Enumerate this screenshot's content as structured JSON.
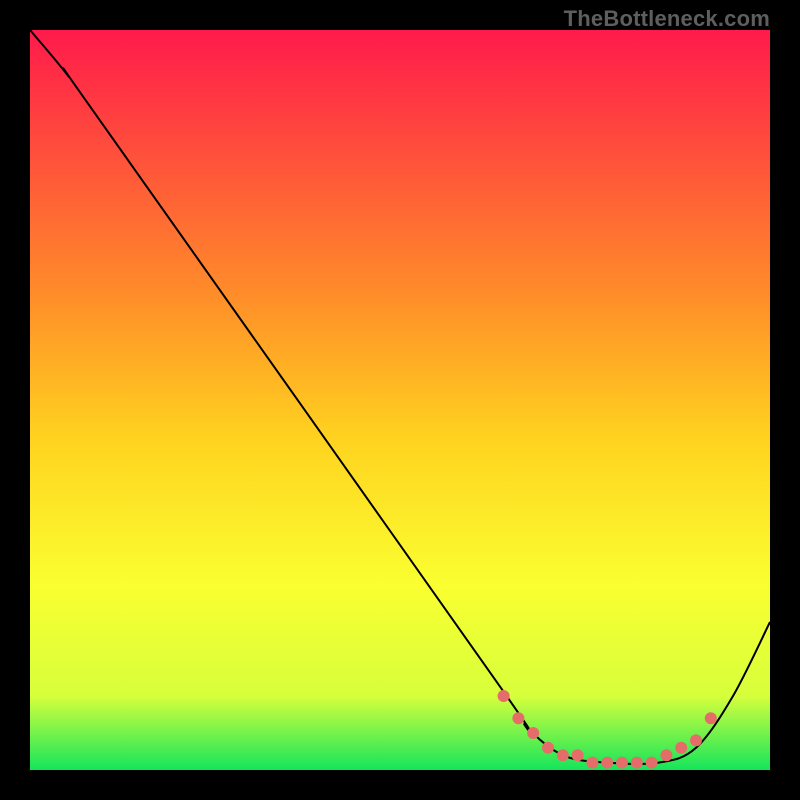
{
  "watermark": "TheBottleneck.com",
  "colors": {
    "bg": "#000000",
    "line": "#000000",
    "marker": "#e46d6a",
    "grad_top": "#ff1a4b",
    "grad_mid_up": "#ff8a2a",
    "grad_mid": "#ffd21f",
    "grad_mid_low": "#faff30",
    "grad_low": "#d6ff3b",
    "grad_bottom": "#14e55b"
  },
  "chart_data": {
    "type": "line",
    "title": "",
    "xlabel": "",
    "ylabel": "",
    "xlim": [
      0,
      100
    ],
    "ylim": [
      0,
      100
    ],
    "background_gradient": {
      "direction": "top-to-bottom",
      "stops": [
        {
          "pos": 0.0,
          "color": "#ff1a4b"
        },
        {
          "pos": 0.35,
          "color": "#ff8a2a"
        },
        {
          "pos": 0.55,
          "color": "#ffd21f"
        },
        {
          "pos": 0.75,
          "color": "#faff30"
        },
        {
          "pos": 0.9,
          "color": "#d6ff3b"
        },
        {
          "pos": 1.0,
          "color": "#14e55b"
        }
      ]
    },
    "series": [
      {
        "name": "curve",
        "points": [
          {
            "x": 0,
            "y": 100
          },
          {
            "x": 5,
            "y": 94
          },
          {
            "x": 10,
            "y": 87
          },
          {
            "x": 63,
            "y": 12
          },
          {
            "x": 67,
            "y": 6
          },
          {
            "x": 72,
            "y": 2
          },
          {
            "x": 78,
            "y": 1
          },
          {
            "x": 85,
            "y": 1
          },
          {
            "x": 90,
            "y": 3
          },
          {
            "x": 95,
            "y": 10
          },
          {
            "x": 100,
            "y": 20
          }
        ]
      }
    ],
    "markers": [
      {
        "x": 64,
        "y": 10
      },
      {
        "x": 66,
        "y": 7
      },
      {
        "x": 68,
        "y": 5
      },
      {
        "x": 70,
        "y": 3
      },
      {
        "x": 72,
        "y": 2
      },
      {
        "x": 74,
        "y": 2
      },
      {
        "x": 76,
        "y": 1
      },
      {
        "x": 78,
        "y": 1
      },
      {
        "x": 80,
        "y": 1
      },
      {
        "x": 82,
        "y": 1
      },
      {
        "x": 84,
        "y": 1
      },
      {
        "x": 86,
        "y": 2
      },
      {
        "x": 88,
        "y": 3
      },
      {
        "x": 90,
        "y": 4
      },
      {
        "x": 92,
        "y": 7
      }
    ]
  }
}
